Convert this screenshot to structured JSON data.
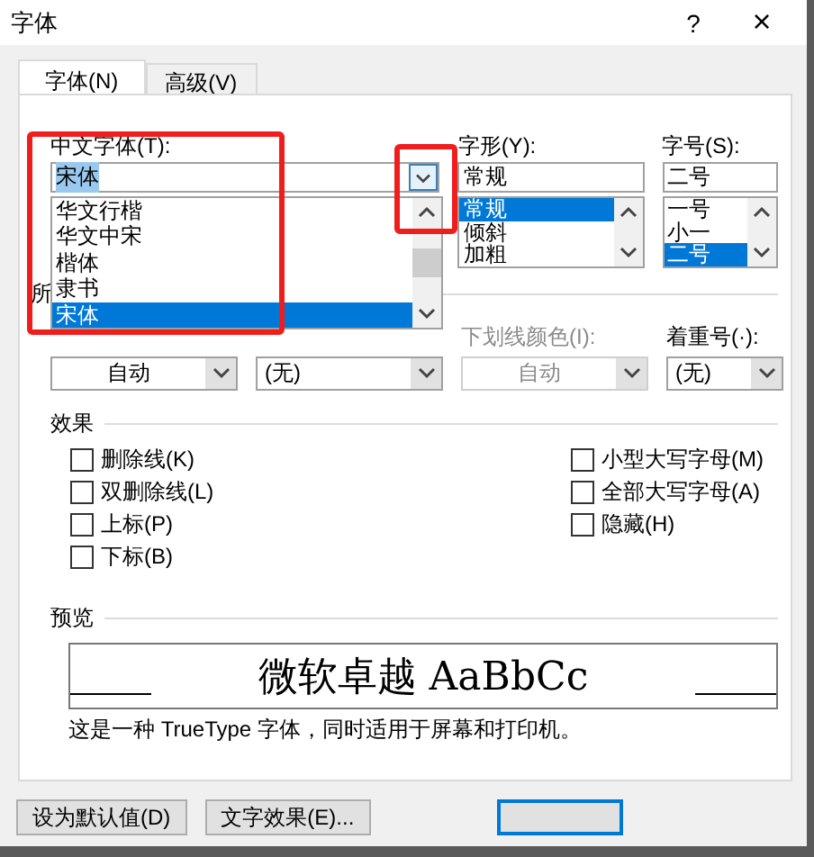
{
  "window": {
    "title": "字体",
    "help": "?",
    "close": "×"
  },
  "tabs": [
    {
      "label": "字体(N)",
      "selected": true
    },
    {
      "label": "高级(V)",
      "selected": false
    }
  ],
  "font": {
    "label": "中文字体(T):",
    "value": "宋体",
    "options": [
      {
        "label": "华文行楷",
        "selected": false
      },
      {
        "label": "华文中宋",
        "selected": false
      },
      {
        "label": "楷体",
        "selected": false
      },
      {
        "label": "隶书",
        "selected": false
      },
      {
        "label": "宋体",
        "selected": true
      }
    ]
  },
  "style": {
    "label": "字形(Y):",
    "value": "常规",
    "options": [
      {
        "label": "常规",
        "selected": true
      },
      {
        "label": "倾斜",
        "selected": false
      },
      {
        "label": "加粗",
        "selected": false
      }
    ]
  },
  "size": {
    "label": "字号(S):",
    "value": "二号",
    "options": [
      {
        "label": "一号",
        "selected": false
      },
      {
        "label": "小一",
        "selected": false
      },
      {
        "label": "二号",
        "selected": true
      }
    ]
  },
  "all_text_section": "所",
  "dropdowns": [
    {
      "value": "自动",
      "disabled": false
    },
    {
      "value": "(无)",
      "disabled": false
    },
    {
      "label": "下划线颜色(I):",
      "value": "自动",
      "disabled": true
    },
    {
      "label": "着重号(·):",
      "value": "(无)",
      "disabled": false
    }
  ],
  "effects": {
    "title": "效果",
    "left": [
      {
        "label": "删除线(K)",
        "checked": false
      },
      {
        "label": "双删除线(L)",
        "checked": false
      },
      {
        "label": "上标(P)",
        "checked": false
      },
      {
        "label": "下标(B)",
        "checked": false
      }
    ],
    "right": [
      {
        "label": "小型大写字母(M)",
        "checked": false
      },
      {
        "label": "全部大写字母(A)",
        "checked": false
      },
      {
        "label": "隐藏(H)",
        "checked": false
      }
    ]
  },
  "preview": {
    "title": "预览",
    "sample": "微软卓越  AaBbCc",
    "note": "这是一种 TrueType 字体，同时适用于屏幕和打印机。"
  },
  "buttons": [
    {
      "label": "设为默认值(D)",
      "kind": "normal"
    },
    {
      "label": "文字效果(E)...",
      "kind": "normal"
    },
    {
      "kind": "default"
    }
  ]
}
